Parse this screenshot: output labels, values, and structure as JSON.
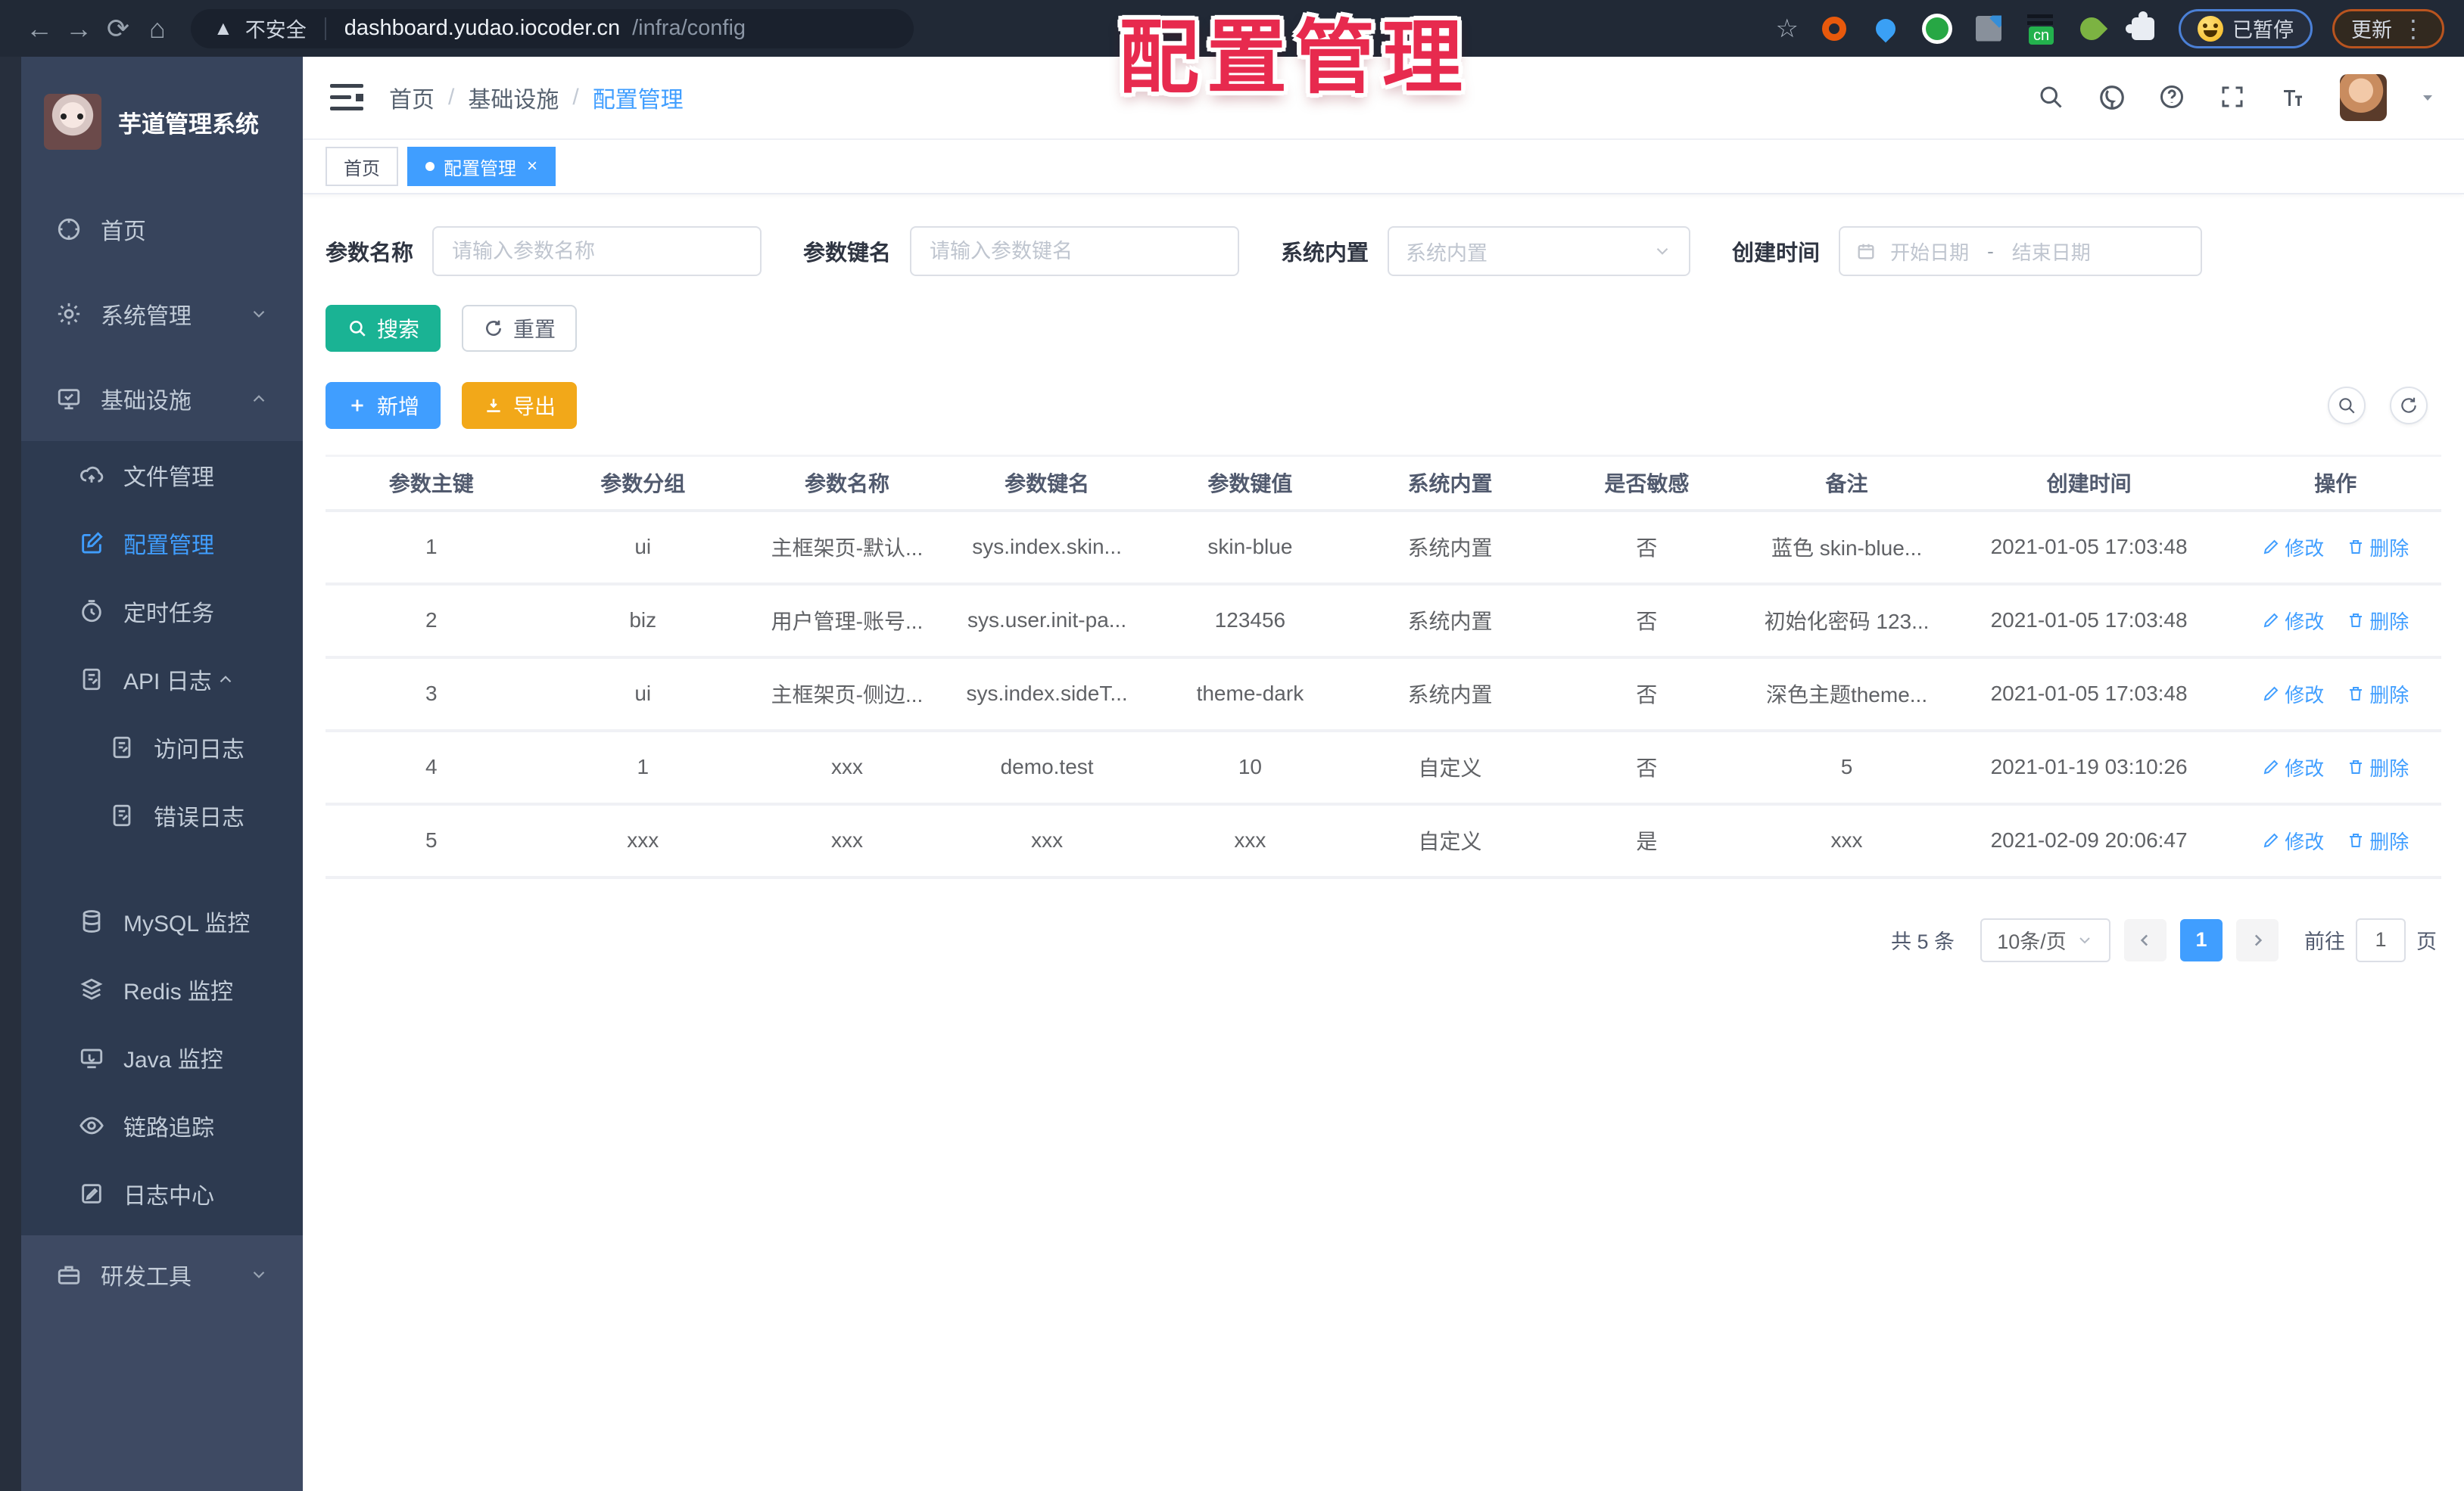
{
  "browser": {
    "security_label": "不安全",
    "url_host": "dashboard.yudao.iocoder.cn",
    "url_path": "/infra/config",
    "cn_badge": "cn",
    "paused_label": "已暂停",
    "update_label": "更新"
  },
  "watermark": "配置管理",
  "sidebar": {
    "title": "芋道管理系统",
    "items": [
      {
        "label": "首页"
      },
      {
        "label": "系统管理"
      },
      {
        "label": "基础设施"
      },
      {
        "label": "文件管理"
      },
      {
        "label": "配置管理"
      },
      {
        "label": "定时任务"
      },
      {
        "label": "API 日志"
      },
      {
        "label": "访问日志"
      },
      {
        "label": "错误日志"
      },
      {
        "label": "MySQL 监控"
      },
      {
        "label": "Redis 监控"
      },
      {
        "label": "Java 监控"
      },
      {
        "label": "链路追踪"
      },
      {
        "label": "日志中心"
      },
      {
        "label": "研发工具"
      }
    ]
  },
  "header": {
    "breadcrumb": [
      "首页",
      "基础设施",
      "配置管理"
    ]
  },
  "tabs": [
    {
      "label": "首页"
    },
    {
      "label": "配置管理"
    }
  ],
  "filters": {
    "name_label": "参数名称",
    "name_placeholder": "请输入参数名称",
    "key_label": "参数键名",
    "key_placeholder": "请输入参数键名",
    "type_label": "系统内置",
    "type_placeholder": "系统内置",
    "time_label": "创建时间",
    "start_placeholder": "开始日期",
    "range_separator": "-",
    "end_placeholder": "结束日期",
    "search_label": "搜索",
    "reset_label": "重置"
  },
  "toolbar": {
    "add_label": "新增",
    "export_label": "导出"
  },
  "table": {
    "columns": [
      "参数主键",
      "参数分组",
      "参数名称",
      "参数键名",
      "参数键值",
      "系统内置",
      "是否敏感",
      "备注",
      "创建时间",
      "操作"
    ],
    "edit_label": "修改",
    "delete_label": "删除",
    "rows": [
      {
        "cells": [
          "1",
          "ui",
          "主框架页-默认...",
          "sys.index.skin...",
          "skin-blue",
          "系统内置",
          "否",
          "蓝色 skin-blue...",
          "2021-01-05 17:03:48"
        ]
      },
      {
        "cells": [
          "2",
          "biz",
          "用户管理-账号...",
          "sys.user.init-pa...",
          "123456",
          "系统内置",
          "否",
          "初始化密码 123...",
          "2021-01-05 17:03:48"
        ]
      },
      {
        "cells": [
          "3",
          "ui",
          "主框架页-侧边...",
          "sys.index.sideT...",
          "theme-dark",
          "系统内置",
          "否",
          "深色主题theme...",
          "2021-01-05 17:03:48"
        ]
      },
      {
        "cells": [
          "4",
          "1",
          "xxx",
          "demo.test",
          "10",
          "自定义",
          "否",
          "5",
          "2021-01-19 03:10:26"
        ]
      },
      {
        "cells": [
          "5",
          "xxx",
          "xxx",
          "xxx",
          "xxx",
          "自定义",
          "是",
          "xxx",
          "2021-02-09 20:06:47"
        ]
      }
    ]
  },
  "pagination": {
    "total": "共 5 条",
    "page_size": "10条/页",
    "current": "1",
    "goto_label": "前往",
    "goto_value": "1",
    "unit_label": "页"
  },
  "colors": {
    "primary": "#409eff",
    "search_button": "#1ab394",
    "export_button": "#f2a819",
    "watermark_red": "#e72a4e",
    "sidebar_bg": "#37445c",
    "submenu_bg": "#2d3a50",
    "browser_bar": "#212936",
    "link": "#409eff"
  }
}
